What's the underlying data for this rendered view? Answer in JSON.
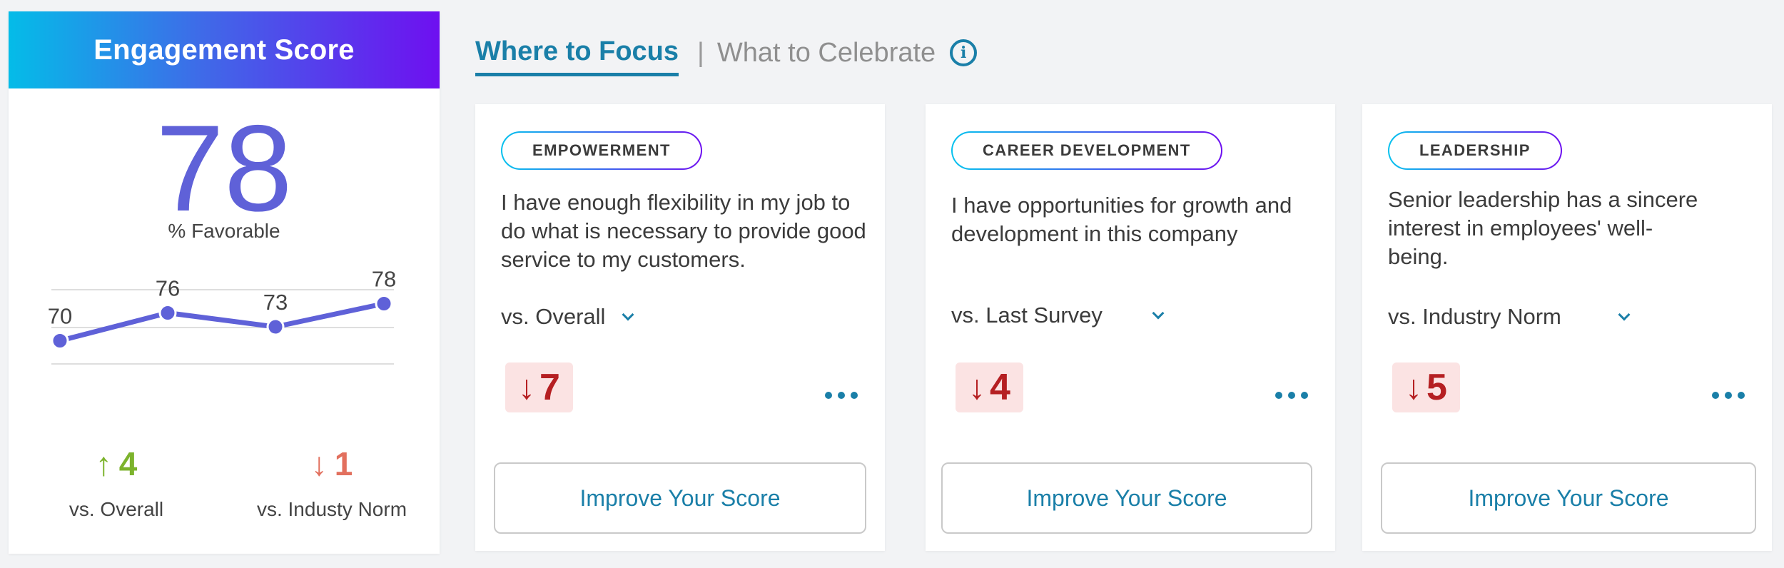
{
  "engagement": {
    "title": "Engagement Score",
    "score": "78",
    "score_label": "% Favorable",
    "trend": {
      "values": [
        70,
        76,
        73,
        78
      ],
      "labels": [
        "70",
        "76",
        "73",
        "78"
      ],
      "color": "#5f61d8"
    },
    "vs_overall": {
      "arrow": "↑",
      "value": "4",
      "label": "vs. Overall",
      "direction": "up",
      "color": "#7cb32c"
    },
    "vs_industry": {
      "arrow": "↓",
      "value": "1",
      "label": "vs. Industy Norm",
      "direction": "down",
      "color": "#e2705e"
    }
  },
  "tabs": {
    "active": "Where to Focus",
    "separator": "|",
    "inactive": "What to Celebrate",
    "info_icon": "info-icon"
  },
  "cards": [
    {
      "category": "EMPOWERMENT",
      "question": "I have enough flexibility in my job to do what is necessary to provide good service to my customers.",
      "comparison": "vs. Overall",
      "change_arrow": "↓",
      "change_value": "7",
      "button": "Improve Your Score"
    },
    {
      "category": "CAREER DEVELOPMENT",
      "question": "I have opportunities for growth and development in this company",
      "comparison": "vs. Last Survey",
      "change_arrow": "↓",
      "change_value": "4",
      "button": "Improve Your Score"
    },
    {
      "category": "LEADERSHIP",
      "question": "Senior leadership has a sincere interest in employees' well-being.",
      "comparison": "vs. Industry Norm",
      "change_arrow": "↓",
      "change_value": "5",
      "button": "Improve Your Score"
    }
  ],
  "colors": {
    "accent": "#1a7fa8",
    "header_gradient_start": "#04bce8",
    "header_gradient_end": "#6e10f0",
    "negative_badge_bg": "#fbe3e3",
    "negative_text": "#b51f22"
  }
}
